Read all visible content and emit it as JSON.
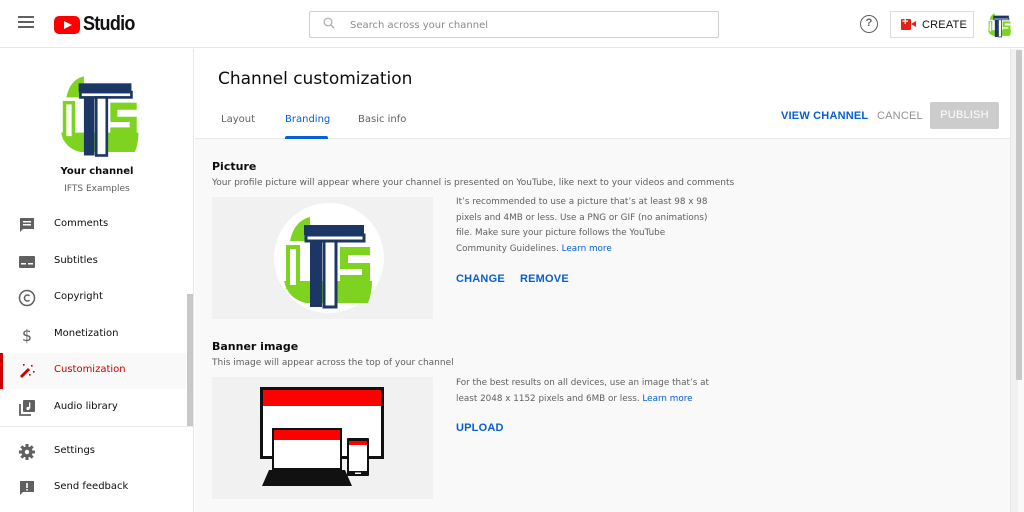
{
  "header": {
    "app_name": "Studio",
    "search_placeholder": "Search across your channel",
    "create_label": "CREATE",
    "help_glyph": "?"
  },
  "sidebar": {
    "your_channel_label": "Your channel",
    "channel_name": "IFTS Examples",
    "items": [
      {
        "label": "Comments",
        "icon": "comment-icon",
        "active": false
      },
      {
        "label": "Subtitles",
        "icon": "subtitles-icon",
        "active": false
      },
      {
        "label": "Copyright",
        "icon": "copyright-icon",
        "active": false
      },
      {
        "label": "Monetization",
        "icon": "dollar-icon",
        "active": false
      },
      {
        "label": "Customization",
        "icon": "magic-wand-icon",
        "active": true
      },
      {
        "label": "Audio library",
        "icon": "audio-library-icon",
        "active": false
      }
    ],
    "footer_items": [
      {
        "label": "Settings",
        "icon": "gear-icon"
      },
      {
        "label": "Send feedback",
        "icon": "feedback-icon"
      }
    ]
  },
  "main": {
    "title": "Channel customization",
    "tabs": [
      {
        "label": "Layout",
        "active": false
      },
      {
        "label": "Branding",
        "active": true
      },
      {
        "label": "Basic info",
        "active": false
      }
    ],
    "actions": {
      "view_channel": "VIEW CHANNEL",
      "cancel": "CANCEL",
      "publish": "PUBLISH"
    },
    "picture": {
      "title": "Picture",
      "description": "Your profile picture will appear where your channel is presented on YouTube, like next to your videos and comments",
      "info": "It’s recommended to use a picture that’s at least 98 x 98 pixels and 4MB or less. Use a PNG or GIF (no animations) file. Make sure your picture follows the YouTube Community Guidelines.",
      "learn_more": "Learn more",
      "change": "CHANGE",
      "remove": "REMOVE"
    },
    "banner": {
      "title": "Banner image",
      "description": "This image will appear across the top of your channel",
      "info": "For the best results on all devices, use an image that’s at least 2048 x 1152 pixels and 6MB or less.",
      "learn_more": "Learn more",
      "upload": "UPLOAD"
    }
  },
  "colors": {
    "brand_red": "#ff0000",
    "accent_blue": "#065fd4",
    "active_red": "#cc0000",
    "logo_green": "#7ed321",
    "logo_navy": "#1c3766"
  }
}
